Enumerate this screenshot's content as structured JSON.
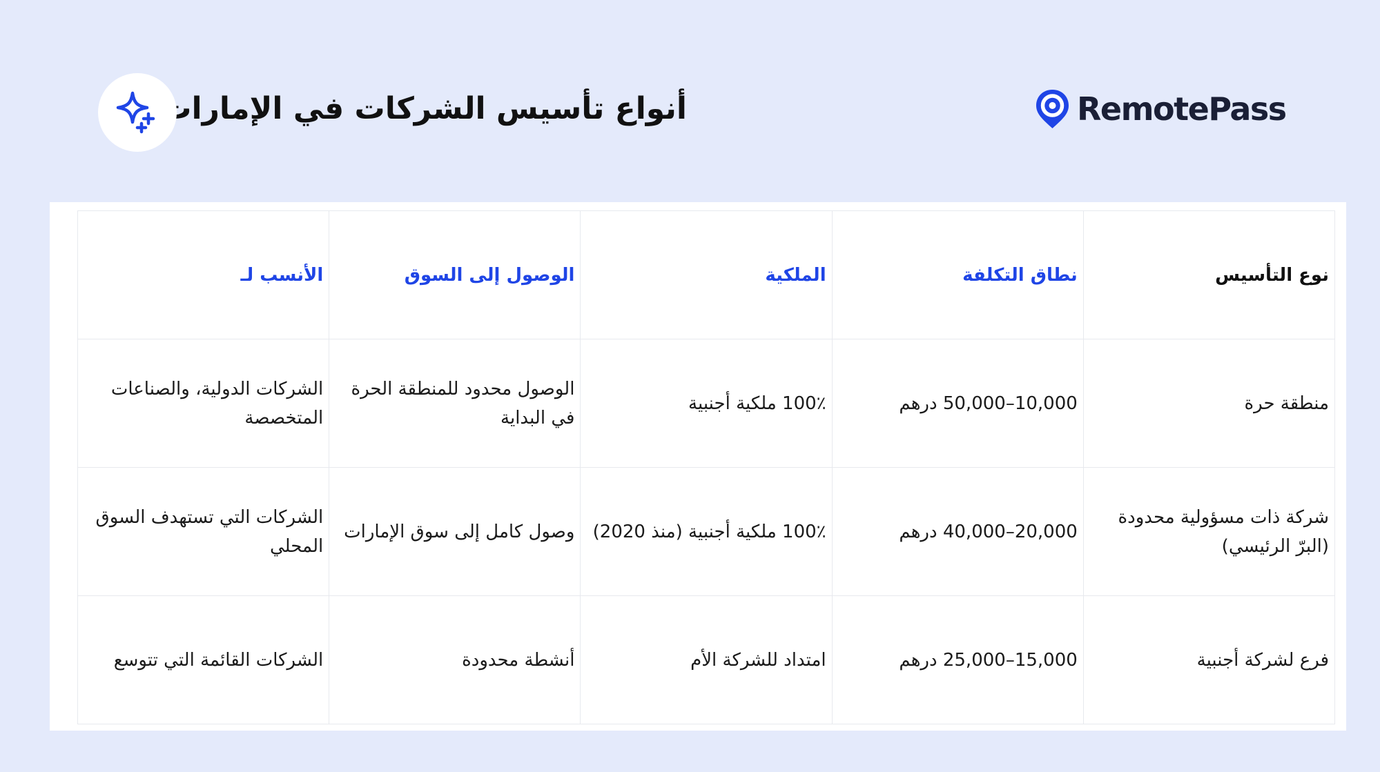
{
  "header": {
    "title": "أنواع تأسيس الشركات في الإمارات",
    "logo_text": "RemotePass",
    "logo_icon": "location-pin-icon",
    "badge_icon": "sparkle-icon"
  },
  "colors": {
    "background": "#e4eafb",
    "accent": "#1f45e6",
    "header_text": "#111111"
  },
  "table": {
    "columns": [
      "نوع التأسيس",
      "نطاق التكلفة",
      "الملكية",
      "الوصول إلى السوق",
      "الأنسب لـ"
    ],
    "rows": [
      {
        "type": "منطقة حرة",
        "cost": "10,000–50,000 درهم",
        "ownership": "100٪ ملكية أجنبية",
        "market": "الوصول محدود للمنطقة الحرة في البداية",
        "best_for": "الشركات الدولية، والصناعات المتخصصة"
      },
      {
        "type": "شركة ذات مسؤولية محدودة (البرّ الرئيسي)",
        "cost": "20,000–40,000 درهم",
        "ownership": "100٪ ملكية أجنبية (منذ 2020)",
        "market": "وصول كامل إلى سوق الإمارات",
        "best_for": "الشركات التي تستهدف السوق المحلي"
      },
      {
        "type": "فرع لشركة أجنبية",
        "cost": "15,000–25,000 درهم",
        "ownership": "امتداد للشركة الأم",
        "market": "أنشطة محدودة",
        "best_for": "الشركات القائمة التي تتوسع"
      }
    ]
  }
}
